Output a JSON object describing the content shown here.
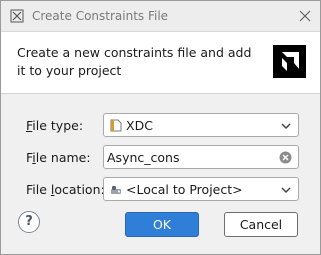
{
  "window": {
    "title": "Create Constraints File",
    "app_icon": "vivado-app-icon",
    "close_icon": "close-icon"
  },
  "header": {
    "description": "Create a new constraints file and add it to your project",
    "logo": "amd-logo"
  },
  "form": {
    "file_type": {
      "label_mnemonic": "F",
      "label_rest": "ile type:",
      "value": "XDC",
      "icon": "xdc-file-icon"
    },
    "file_name": {
      "label_prefix": "F",
      "label_mnemonic": "i",
      "label_rest": "le name:",
      "value": "Async_cons"
    },
    "file_location": {
      "label_prefix": "File ",
      "label_mnemonic": "l",
      "label_rest": "ocation:",
      "value": "<Local to Project>",
      "icon": "local-project-icon"
    }
  },
  "buttons": {
    "help": "?",
    "ok": "OK",
    "cancel": "Cancel"
  },
  "colors": {
    "primary_button": "#2f7fd8",
    "background": "#f0f0f0",
    "header_background": "#ffffff"
  }
}
